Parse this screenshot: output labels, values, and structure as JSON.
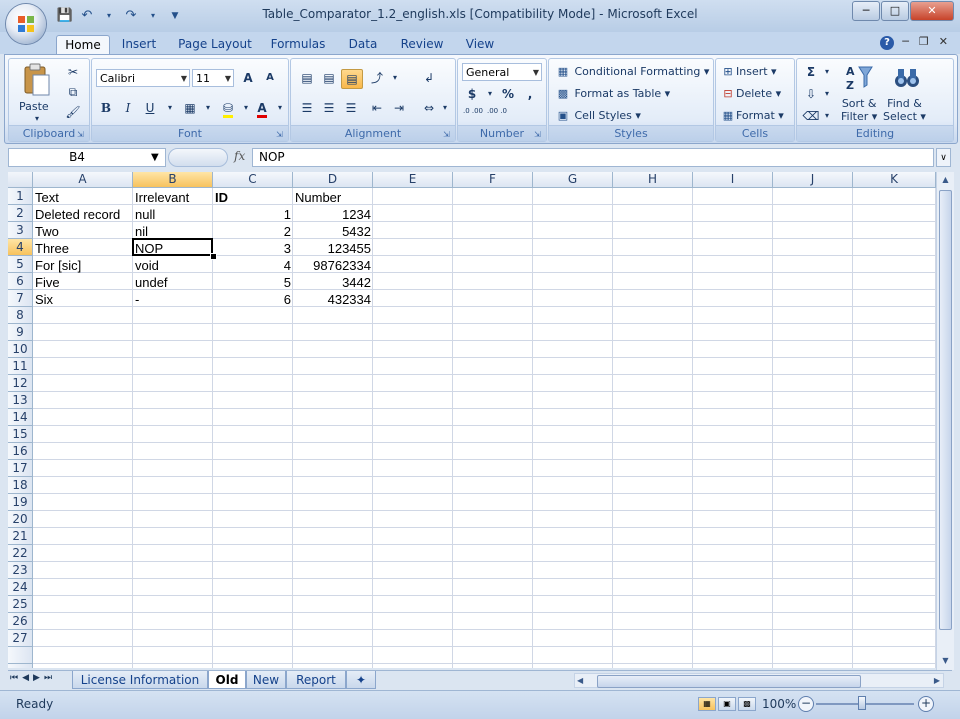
{
  "window": {
    "title": "Table_Comparator_1.2_english.xls  [Compatibility Mode] - Microsoft Excel"
  },
  "ribbon_tabs": [
    "Home",
    "Insert",
    "Page Layout",
    "Formulas",
    "Data",
    "Review",
    "View"
  ],
  "active_tab": "Home",
  "ribbon": {
    "clipboard": {
      "label": "Clipboard",
      "paste": "Paste"
    },
    "font": {
      "label": "Font",
      "name": "Calibri",
      "size": "11",
      "grow": "A",
      "shrink": "A",
      "bold": "B",
      "italic": "I",
      "underline": "U",
      "font_color": "A"
    },
    "alignment": {
      "label": "Alignment"
    },
    "number": {
      "label": "Number",
      "format": "General",
      "currency": "$",
      "percent": "%",
      "comma": ",",
      "inc_dec": ".0 .00",
      "dec_dec": ".00 .0"
    },
    "styles": {
      "label": "Styles",
      "conditional": "Conditional Formatting",
      "format_table": "Format as Table",
      "cell_styles": "Cell Styles"
    },
    "cells": {
      "label": "Cells",
      "insert": "Insert",
      "delete": "Delete",
      "format": "Format"
    },
    "editing": {
      "label": "Editing",
      "sort": "Sort &",
      "filter": "Filter",
      "find": "Find &",
      "select": "Select"
    }
  },
  "formula_bar": {
    "name_box": "B4",
    "fx": "fx",
    "value": "NOP"
  },
  "sheet": {
    "columns": [
      "A",
      "B",
      "C",
      "D",
      "E",
      "F",
      "G",
      "H",
      "I",
      "J",
      "K"
    ],
    "selected_column": "B",
    "selected_row": 4,
    "row_count": 27,
    "rows": [
      [
        "Text",
        "Irrelevant",
        "ID",
        "Number"
      ],
      [
        "Deleted record",
        "null",
        "1",
        "1234"
      ],
      [
        "Two",
        "nil",
        "2",
        "5432"
      ],
      [
        "Three",
        "NOP",
        "3",
        "123455"
      ],
      [
        "For [sic]",
        "void",
        "4",
        "98762334"
      ],
      [
        "Five",
        "undef",
        "5",
        "3442"
      ],
      [
        "Six",
        "-",
        "6",
        "432334"
      ]
    ]
  },
  "sheet_tabs": [
    "License Information",
    "Old",
    "New",
    "Report"
  ],
  "active_sheet": "Old",
  "status": {
    "text": "Ready",
    "zoom": "100%"
  }
}
